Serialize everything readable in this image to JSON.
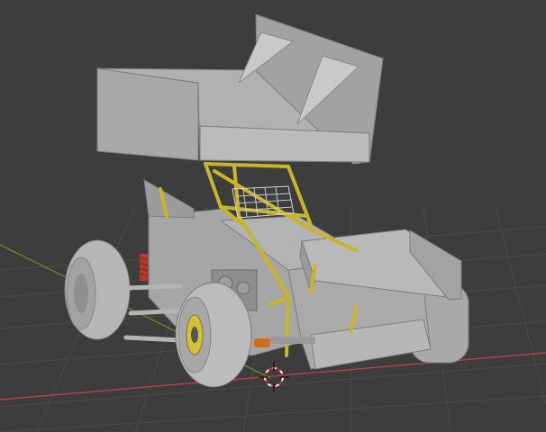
{
  "viewport": {
    "background": "#3d3d3d",
    "grid_color": "#4a4a4a",
    "x_axis_color": "#b2424a",
    "y_axis_color": "#5c8a2c",
    "cursor_icon": "3d-cursor-icon"
  },
  "model": {
    "object": "sprint-car",
    "body_color": "#a7a7a7",
    "chassis_color": "#c9b52a",
    "tire_color": "#b4b4b4",
    "shock_spring_color": "#b53a2a"
  }
}
